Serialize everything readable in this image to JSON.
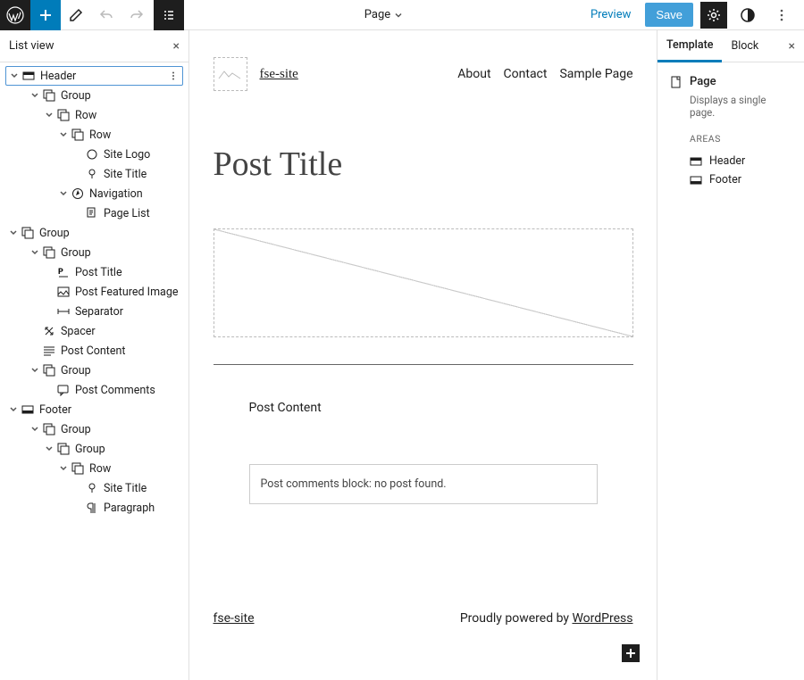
{
  "topbar": {
    "document_label": "Page",
    "preview_label": "Preview",
    "save_label": "Save"
  },
  "left_panel": {
    "title": "List view"
  },
  "tree": {
    "header": "Header",
    "group": "Group",
    "row": "Row",
    "site_logo": "Site Logo",
    "site_title": "Site Title",
    "navigation": "Navigation",
    "page_list": "Page List",
    "post_title": "Post Title",
    "post_featured_image": "Post Featured Image",
    "separator": "Separator",
    "spacer": "Spacer",
    "post_content": "Post Content",
    "post_comments": "Post Comments",
    "footer": "Footer",
    "paragraph": "Paragraph"
  },
  "canvas": {
    "site_title": "fse-site",
    "nav": {
      "about": "About",
      "contact": "Contact",
      "sample": "Sample Page"
    },
    "post_title": "Post Title",
    "post_content_label": "Post Content",
    "comments_placeholder": "Post comments block: no post found.",
    "footer_site": "fse-site",
    "footer_text": "Proudly powered by ",
    "footer_wp": "WordPress"
  },
  "right_panel": {
    "tab_template": "Template",
    "tab_block": "Block",
    "page_label": "Page",
    "page_desc": "Displays a single page.",
    "areas_label": "AREAS",
    "header": "Header",
    "footer": "Footer"
  }
}
